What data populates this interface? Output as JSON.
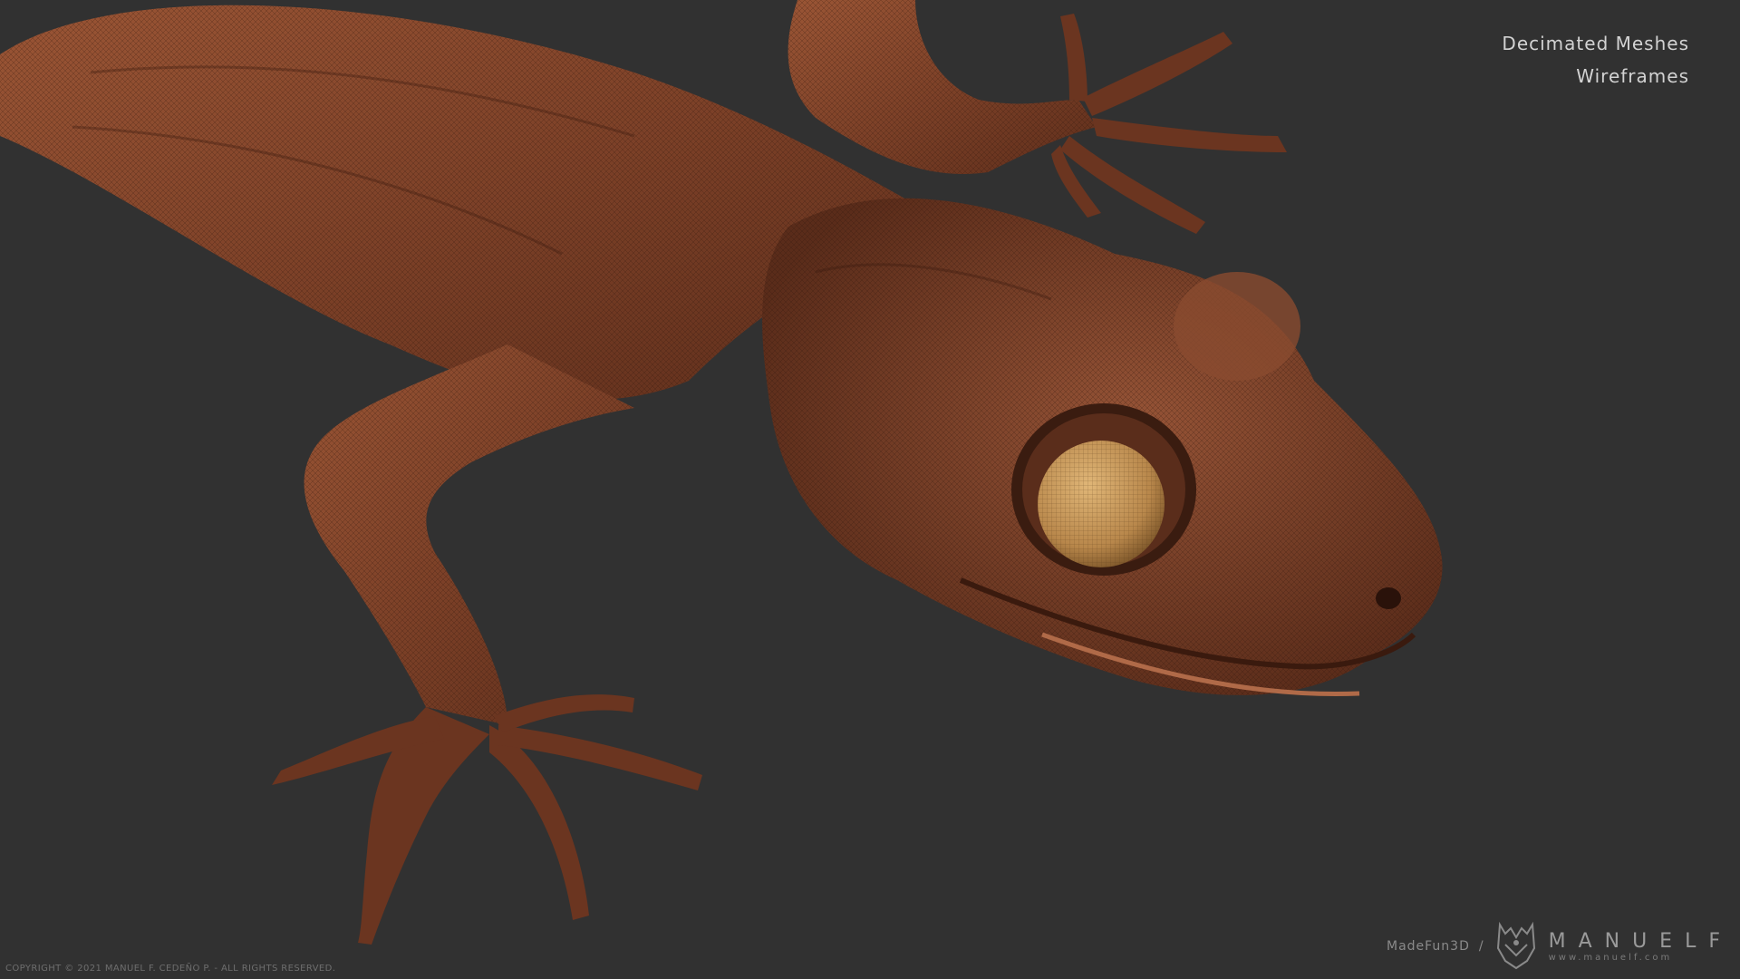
{
  "scene": {
    "subject": "gecko-3d-model",
    "background_color": "#313131",
    "skin_color": "#8a4a2e",
    "eye_color": "#c89a5a"
  },
  "labels": {
    "line1": "Decimated Meshes",
    "line2": "Wireframes"
  },
  "footer": {
    "copyright": "COPYRIGHT © 2021 MANUEL F. CEDEÑO P. - ALL RIGHTS RESERVED.",
    "brand_prefix": "MadeFun3D",
    "brand_separator": "/",
    "brand_name": "MANUELF",
    "brand_url": "www.manuelf.com"
  }
}
